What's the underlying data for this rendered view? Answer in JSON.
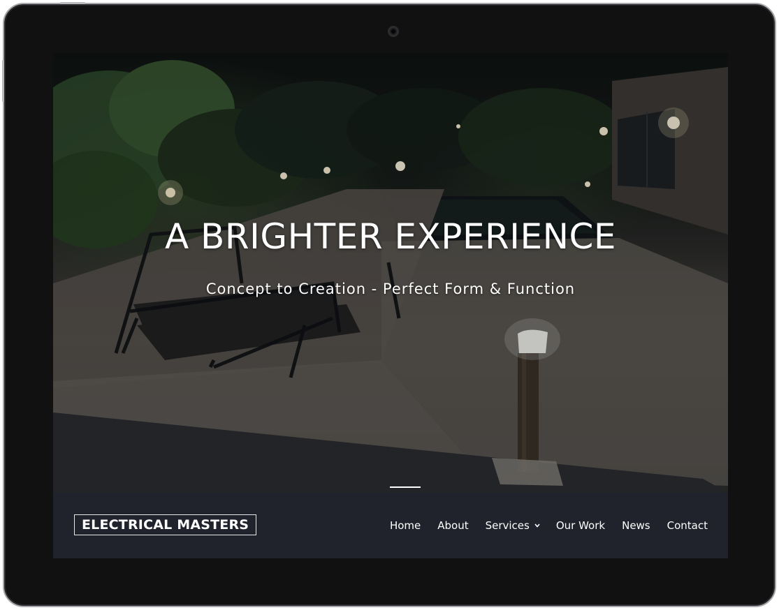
{
  "hero": {
    "title": "A BRIGHTER EXPERIENCE",
    "subtitle": "Concept to Creation - Perfect Form & Function"
  },
  "navbar": {
    "logo": "ELECTRICAL MASTERS",
    "items": [
      {
        "label": "Home",
        "active": true
      },
      {
        "label": "About"
      },
      {
        "label": "Services",
        "has_dropdown": true
      },
      {
        "label": "Our Work"
      },
      {
        "label": "News"
      },
      {
        "label": "Contact"
      }
    ]
  },
  "colors": {
    "navbar_bg": "#20232c",
    "text": "#ffffff",
    "device_frame": "#111112"
  },
  "icons": {
    "services_dropdown": "chevron-down-icon",
    "camera": "camera-icon"
  }
}
